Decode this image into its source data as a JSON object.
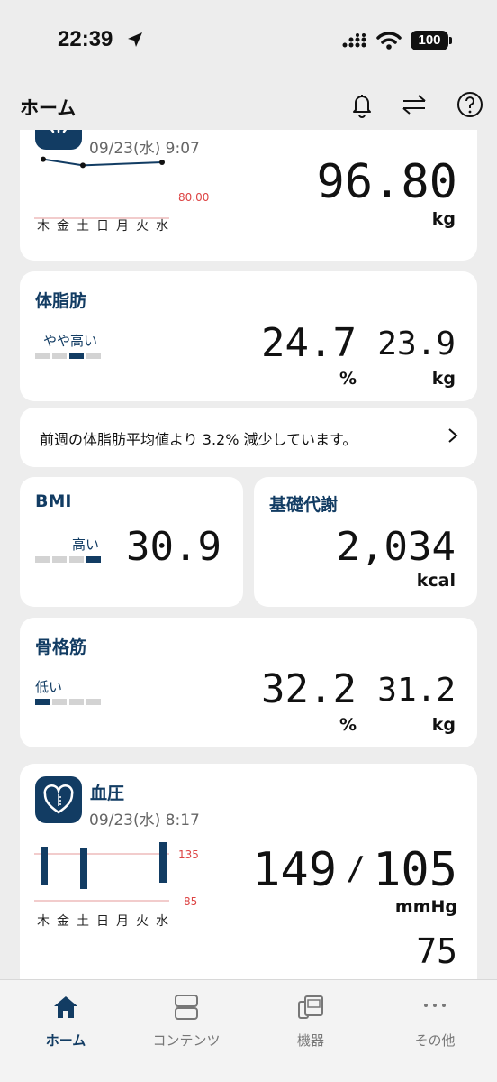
{
  "status": {
    "time": "22:39",
    "battery": "100"
  },
  "header": {
    "title": "ホーム"
  },
  "weight": {
    "datetime": "09/23(水) 9:07",
    "value": "96.80",
    "unit": "kg",
    "goal": "80.00",
    "days": [
      "木",
      "金",
      "土",
      "日",
      "月",
      "火",
      "水"
    ],
    "trend": [
      96.9,
      96.7,
      96.8
    ]
  },
  "body_fat": {
    "title": "体脂肪",
    "level_label": "やや高い",
    "level": 3,
    "percent": "24.7",
    "percent_unit": "%",
    "mass": "23.9",
    "mass_unit": "kg"
  },
  "notice": {
    "text": "前週の体脂肪平均値より 3.2% 減少しています。"
  },
  "bmi": {
    "title": "BMI",
    "level_label": "高い",
    "level": 4,
    "value": "30.9"
  },
  "bmr": {
    "title": "基礎代謝",
    "value": "2,034",
    "unit": "kcal"
  },
  "muscle": {
    "title": "骨格筋",
    "level_label": "低い",
    "level": 1,
    "percent": "32.2",
    "percent_unit": "%",
    "mass": "31.2",
    "mass_unit": "kg"
  },
  "blood_pressure": {
    "title": "血圧",
    "datetime": "09/23(水) 8:17",
    "systolic": "149",
    "separator": "/",
    "diastolic": "105",
    "unit": "mmHg",
    "pulse": "75",
    "upper_ref": "135",
    "lower_ref": "85",
    "days": [
      "木",
      "金",
      "土",
      "日",
      "月",
      "火",
      "水"
    ]
  },
  "tabs": [
    {
      "label": "ホーム",
      "icon": "home-icon",
      "active": true
    },
    {
      "label": "コンテンツ",
      "icon": "contents-icon",
      "active": false
    },
    {
      "label": "機器",
      "icon": "devices-icon",
      "active": false
    },
    {
      "label": "その他",
      "icon": "more-icon",
      "active": false
    }
  ],
  "colors": {
    "accent": "#123c63",
    "background": "#ededed",
    "card": "#ffffff",
    "reference": "#e59a9a"
  }
}
